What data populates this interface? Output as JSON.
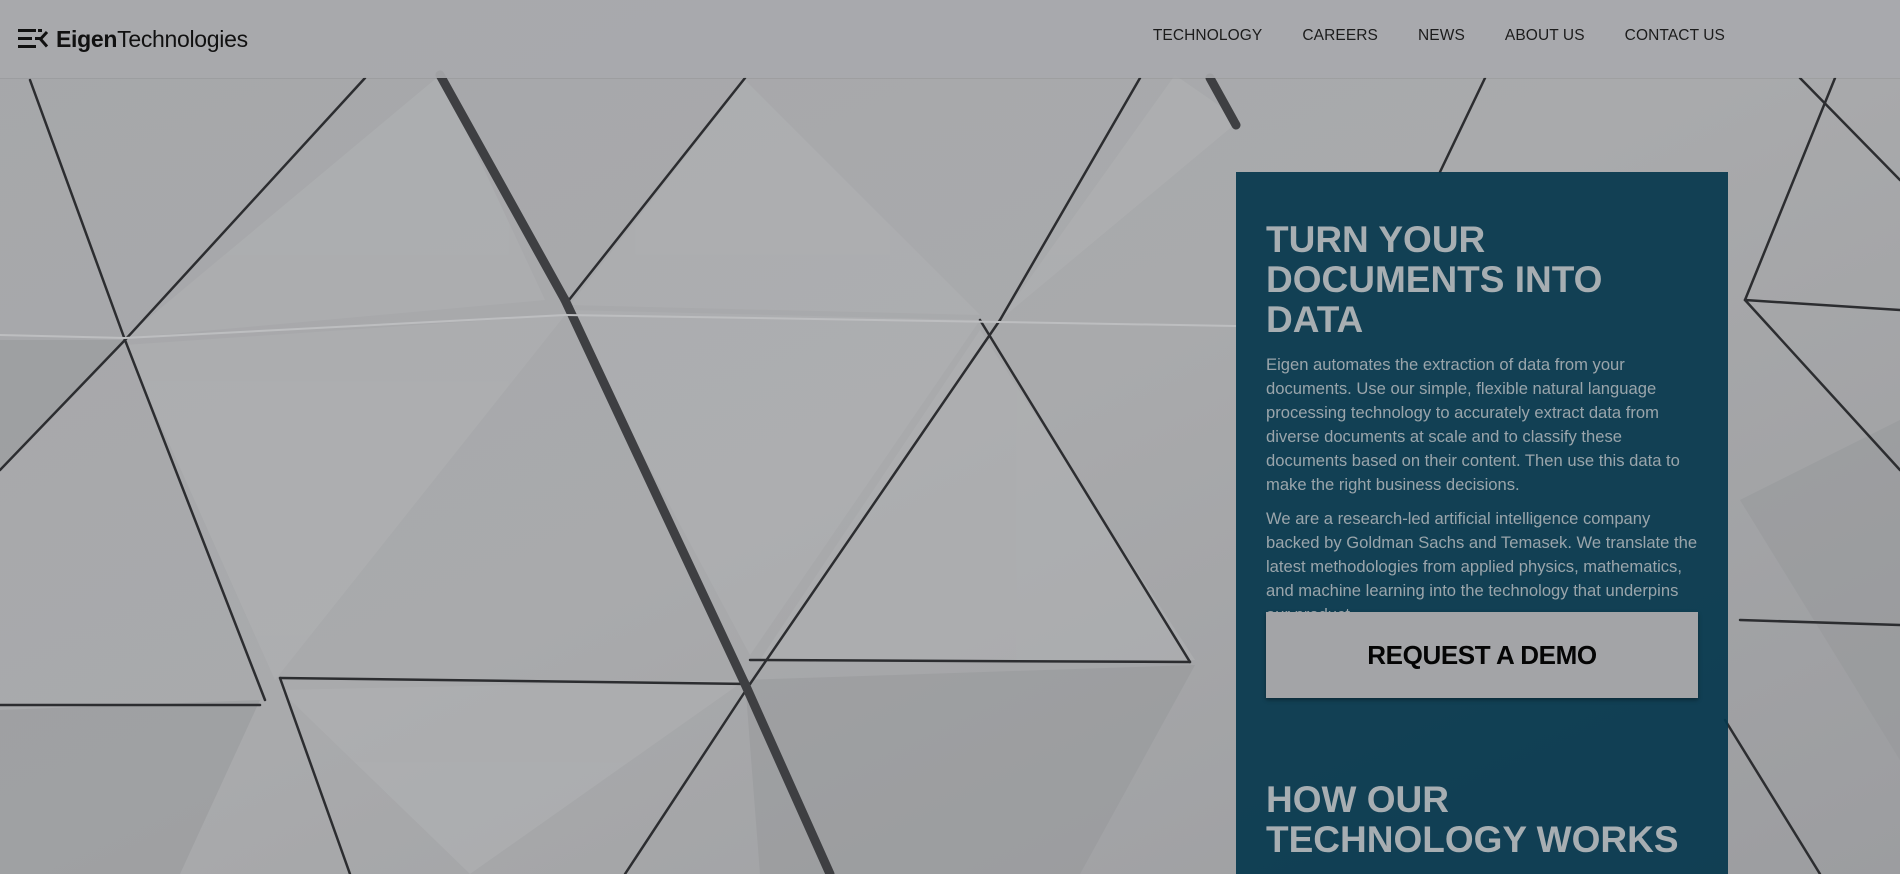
{
  "brand": {
    "name_bold": "Eigen",
    "name_light": "Technologies",
    "logo_icon": "eigen-logo-mark-icon",
    "color": "#111111"
  },
  "nav": {
    "items": [
      {
        "label": "TECHNOLOGY"
      },
      {
        "label": "CAREERS"
      },
      {
        "label": "NEWS"
      },
      {
        "label": "ABOUT US"
      },
      {
        "label": "CONTACT US"
      }
    ]
  },
  "hero": {
    "background": "grey triangular-panel architectural facade",
    "panel_color": "#06384d",
    "headline": "TURN YOUR DOCUMENTS INTO DATA",
    "paragraphs": [
      "Eigen automates the extraction of data from your documents. Use our simple, flexible natural language processing technology to accurately extract data from diverse documents at scale and to classify these documents based on their content. Then use this data to make the right business decisions.",
      "We are a research-led artificial intelligence company backed by Goldman Sachs and Temasek. We translate the latest methodologies from applied physics, mathematics, and machine learning into the technology that underpins our product."
    ],
    "cta_label": "REQUEST A DEMO",
    "section_title": "HOW OUR TECHNOLOGY WORKS"
  }
}
